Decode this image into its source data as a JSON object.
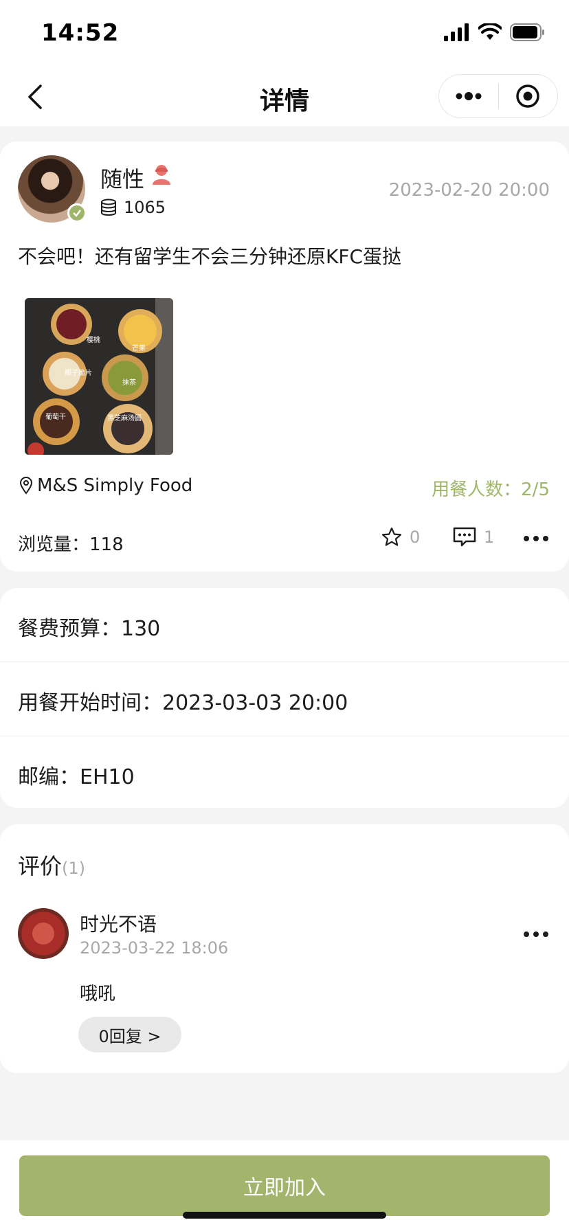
{
  "status_bar": {
    "time": "14:52"
  },
  "nav": {
    "title": "详情"
  },
  "post": {
    "author": "随性",
    "coins": "1065",
    "time": "2023-02-20 20:00",
    "content": "不会吧！还有留学生不会三分钟还原KFC蛋挞",
    "image_labels": [
      "樱桃",
      "芒果",
      "椰子脆片",
      "抹茶",
      "葡萄干",
      "黑芝麻汤圆"
    ],
    "location": "M&S Simply Food",
    "diners": "用餐人数：2/5",
    "views": "浏览量：118",
    "likes": "0",
    "comments": "1"
  },
  "details": {
    "budget": "餐费预算：130",
    "start_time": "用餐开始时间：2023-03-03 20:00",
    "postcode": "邮编：EH10"
  },
  "reviews": {
    "title": "评价",
    "count": "(1)",
    "items": [
      {
        "name": "时光不语",
        "time": "2023-03-22 18:06",
        "text": "哦吼",
        "reply": "0回复 >"
      }
    ]
  },
  "bottom": {
    "join_label": "立即加入"
  },
  "colors": {
    "accent": "#a3b56d",
    "secondary_text": "#a8a8a8",
    "background": "#f4f4f4"
  }
}
